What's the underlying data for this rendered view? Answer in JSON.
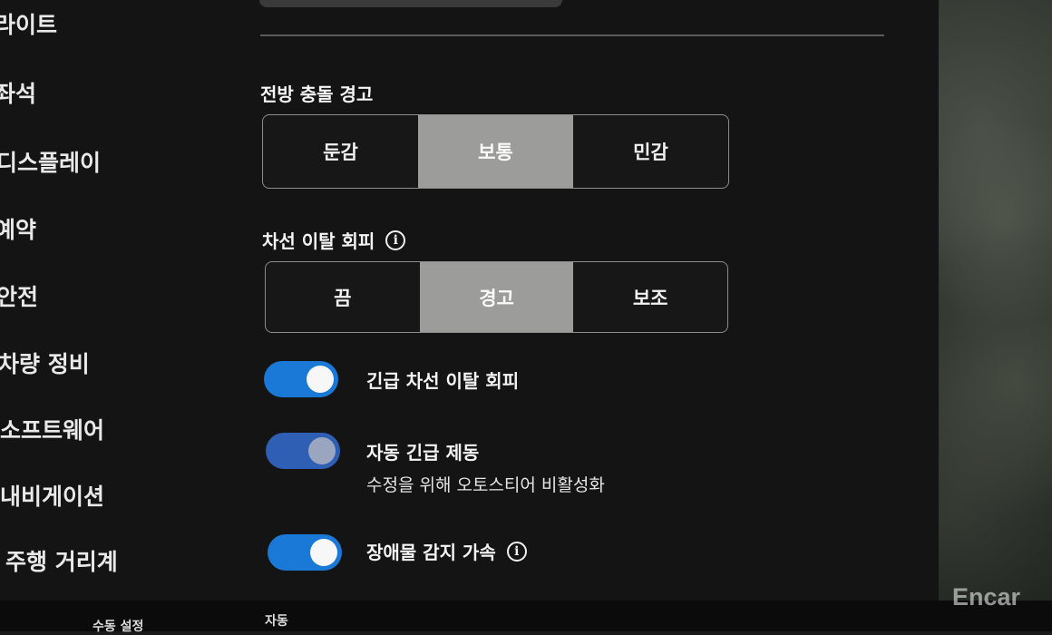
{
  "sidebar": {
    "items": [
      {
        "label": "라이트"
      },
      {
        "label": "좌석"
      },
      {
        "label": "디스플레이"
      },
      {
        "label": "예약"
      },
      {
        "label": "안전"
      },
      {
        "label": "차량 정비"
      },
      {
        "label": "소프트웨어"
      },
      {
        "label": "내비게이션"
      },
      {
        "label": "주행 거리계"
      }
    ]
  },
  "forward_collision": {
    "title": "전방 충돌 경고",
    "options": [
      "둔감",
      "보통",
      "민감"
    ],
    "selected": "보통"
  },
  "lane_departure": {
    "title": "차선 이탈 회피",
    "options": [
      "끔",
      "경고",
      "보조"
    ],
    "selected": "경고"
  },
  "toggles": {
    "emergency_lane": {
      "label": "긴급 차선 이탈 회피",
      "on": true
    },
    "auto_braking": {
      "label": "자동 긴급 제동",
      "sublabel": "수정을 위해 오토스티어 비활성화",
      "on": true
    },
    "obstacle_accel": {
      "label": "장애물 감지 가속",
      "on": true
    }
  },
  "bottom_bar": {
    "left_label": "수동 설정",
    "right_label": "자동"
  },
  "watermark": "Encar",
  "colors": {
    "toggle_on": "#1a78d6",
    "segment_selected": "#9c9c9a",
    "background": "#141414"
  }
}
